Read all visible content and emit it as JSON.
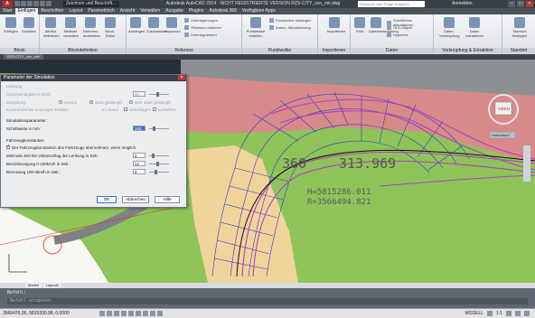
{
  "titlebar": {
    "app_button": "A",
    "workspace": "Zeichnen und Beschrift...",
    "title": "Autodesk AutoCAD 2014 - NICHT REGISTRIERTE VERSION   RZS-CITY_von_mir.dwg",
    "search_placeholder": "Stichwort oder Frage eingeben",
    "login": "Anmelden"
  },
  "tabs": [
    "Start",
    "Einfügen",
    "Beschriften",
    "Layout",
    "Parametrisch",
    "Ansicht",
    "Verwalten",
    "Ausgabe",
    "Plugins",
    "Autodesk 360",
    "Verfügbare Apps"
  ],
  "active_tab": "Einfügen",
  "ribbon_groups": [
    {
      "label": "Block",
      "buttons": [
        "Einfügen",
        "Erstellen"
      ]
    },
    {
      "label": "Blockdefinition",
      "buttons": [
        "Attribut definieren",
        "Attribute verwalten",
        "Referenz bearbeiten",
        "Block-Editor"
      ]
    },
    {
      "label": "Referenz",
      "buttons": [
        "Anhängen",
        "Zuschneiden",
        "Anpassen"
      ],
      "rows": [
        "Unterlagerungen",
        "*Rahmen variieren*",
        "Unterlegrahmen"
      ]
    },
    {
      "label": "Punktwolke",
      "buttons": [
        "Punktwolke erstellen"
      ],
      "rows": [
        "Punktwolke anhängen",
        "Autom. Aktualisierung"
      ]
    },
    {
      "label": "Importieren",
      "buttons": [
        "Importieren"
      ]
    },
    {
      "label": "Daten",
      "buttons": [
        "Feld",
        "Datenverknüpfung"
      ],
      "rows": [
        "Schriftfelder aktualisieren",
        "OLE-Objekt",
        "Hyperlink"
      ]
    },
    {
      "label": "Verknüpfung & Extraktion",
      "buttons": [
        "Daten-Verknüpfung",
        "Daten extrahieren"
      ]
    },
    {
      "label": "Standort",
      "buttons": [
        "Standort festlegen"
      ]
    }
  ],
  "doc_tab": "RZS-CITY_von_mir*",
  "layout_tabs": [
    "Modell",
    "Layout1"
  ],
  "drawing": {
    "label_num": "360",
    "label_num2": "313.969",
    "coord_h": "H=5815286.011",
    "coord_r": "R=3566494.821",
    "viewcube": "OBEN",
    "wcs": "Unbenannt"
  },
  "command": {
    "line1": "Befehl:",
    "line2": "Befehl:",
    "prompt": "Befehl eingeben"
  },
  "status": {
    "coords": "3566476.36, 5815330.98, 0.0000",
    "model": "MODELL",
    "scale": "1:1"
  },
  "dialog": {
    "title": "Parameter der Simulation",
    "section_lenkung": "Lenkung",
    "speed_label": "Geschwindigkeit in km/h:",
    "speed_value": "50",
    "damping_label": "Dämpfung:",
    "damping_opts": [
      "normal",
      "stark gedämpft",
      "sehr stark gedämpft"
    ],
    "curve_label": "Kurvenfahrt bei unstetigen Radien:",
    "curve_opts": [
      "Im Stand",
      "einschlagen",
      "ausfahren"
    ],
    "sim_section": "Simulationsparameter:",
    "step_label": "Schrittweite in mm:",
    "step_value": "100",
    "vehicle_section": "Fahrzeugkonstanten:",
    "vehicle_chk": "Der Fahrzeugkonstanten des Fahrzeugs übernehmen, wenn möglich",
    "min_time_label": "Minimale Zeit bis Vollanschlag der Lenkung in Sek.:",
    "min_time_value": "4",
    "accel_label": "Beschleunigung 0-100km/h in Sek.:",
    "accel_value": "12",
    "brake_label": "Bremsweg 100-0km/h in Sek.:",
    "brake_value": "8",
    "ok": "OK",
    "cancel": "Abbrechen",
    "help": "Hilfe"
  }
}
